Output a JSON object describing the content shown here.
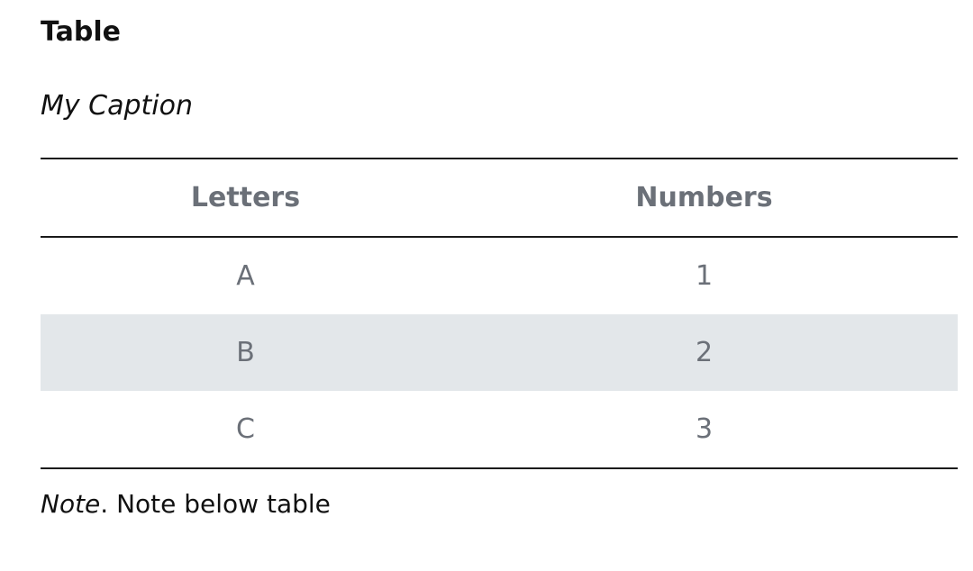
{
  "heading": "Table",
  "caption": "My Caption",
  "table": {
    "headers": [
      "Letters",
      "Numbers"
    ],
    "rows": [
      [
        "A",
        "1"
      ],
      [
        "B",
        "2"
      ],
      [
        "C",
        "3"
      ]
    ]
  },
  "note": {
    "lead": "Note",
    "text": ". Note below table"
  },
  "colors": {
    "header_text": "#6b7078",
    "stripe": "#e3e7ea",
    "rule": "#1a1a1a"
  }
}
